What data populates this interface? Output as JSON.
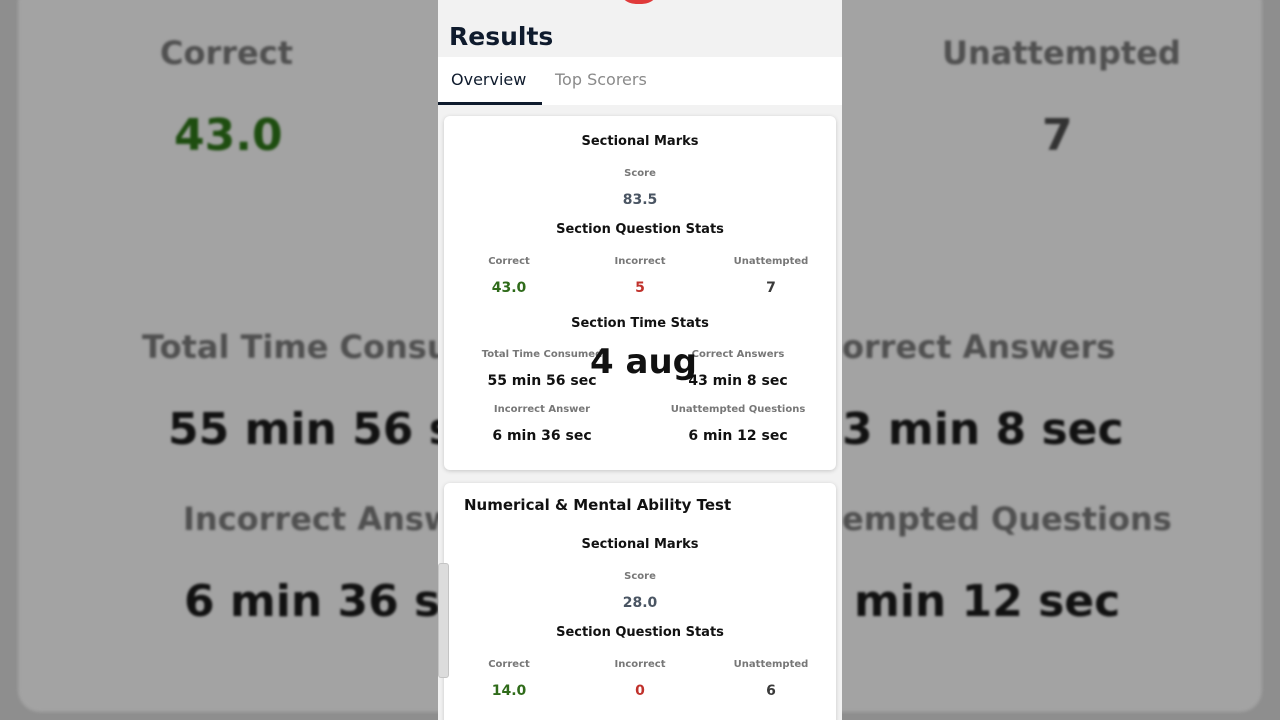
{
  "background": {
    "correct_label": "Correct",
    "correct_value": "43.0",
    "unattempted_label": "Unattempted",
    "unattempted_value": "7",
    "total_time_label": "Total Time Consu",
    "total_time_value": "55 min 56 se",
    "correct_answers_label": "orrect Answers",
    "correct_answers_value": "3 min 8 sec",
    "incorrect_answer_label": "Incorrect Answ",
    "incorrect_answer_value": "6 min 36 se",
    "unattempted_q_label": "empted Questions",
    "unattempted_q_value": "min 12 sec"
  },
  "header": {
    "title": "Results"
  },
  "tabs": [
    {
      "label": "Overview",
      "active": true
    },
    {
      "label": "Top Scorers",
      "active": false
    }
  ],
  "section1": {
    "sectional_marks_heading": "Sectional Marks",
    "score_label": "Score",
    "score_value": "83.5",
    "question_stats_heading": "Section Question Stats",
    "correct_label": "Correct",
    "correct_value": "43.0",
    "incorrect_label": "Incorrect",
    "incorrect_value": "5",
    "unattempted_label": "Unattempted",
    "unattempted_value": "7",
    "time_stats_heading": "Section Time Stats",
    "total_time_label": "Total Time Consumed",
    "total_time_value": "55 min 56 sec",
    "correct_answers_label": "Correct Answers",
    "correct_answers_value": "43 min 8 sec",
    "incorrect_answer_label": "Incorrect Answer",
    "incorrect_answer_value": "6 min 36 sec",
    "unattempted_q_label": "Unattempted Questions",
    "unattempted_q_value": "6 min 12 sec"
  },
  "section2": {
    "name": "Numerical & Mental Ability Test",
    "sectional_marks_heading": "Sectional Marks",
    "score_label": "Score",
    "score_value": "28.0",
    "question_stats_heading": "Section Question Stats",
    "correct_label": "Correct",
    "correct_value": "14.0",
    "incorrect_label": "Incorrect",
    "incorrect_value": "0",
    "unattempted_label": "Unattempted",
    "unattempted_value": "6"
  },
  "overlay": {
    "date_text": "4 aug"
  },
  "colors": {
    "correct": "#2f6b1a",
    "incorrect": "#c0312b",
    "active_tab": "#0f1b2d",
    "brand_logo": "#e03a3a"
  }
}
